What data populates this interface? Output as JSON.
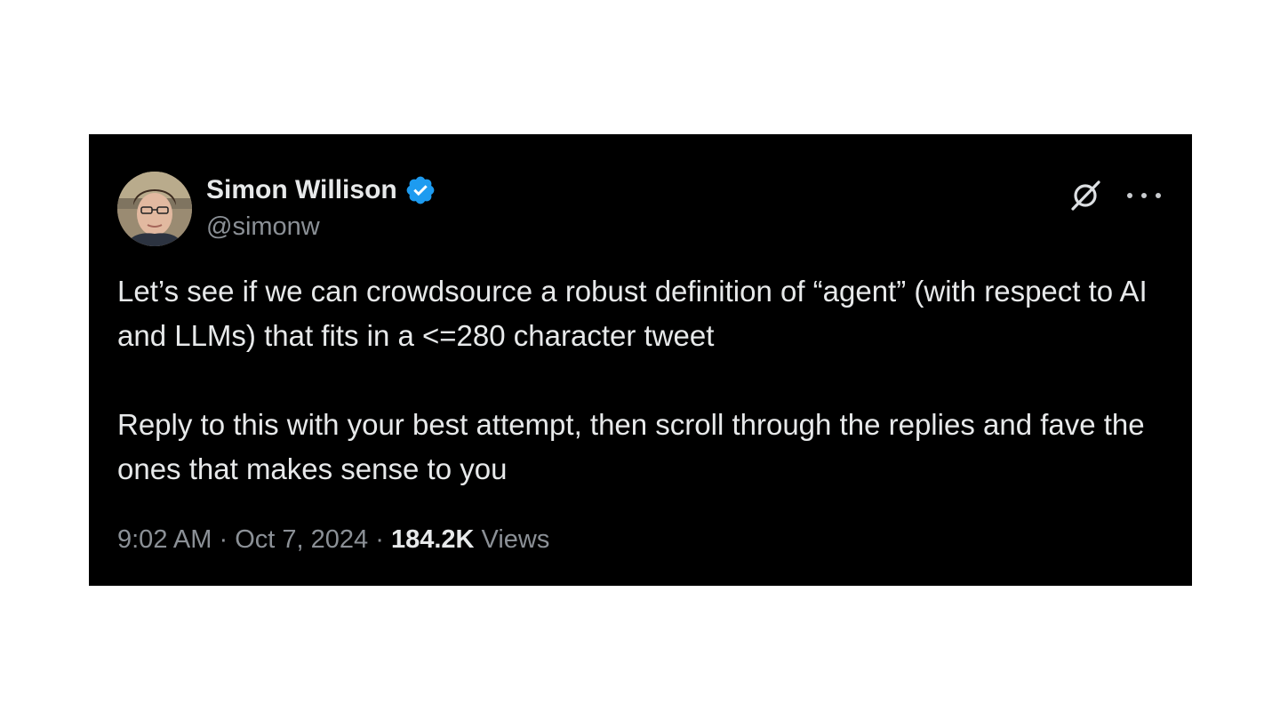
{
  "tweet": {
    "author": {
      "name": "Simon Willison",
      "handle": "@simonw",
      "verified": true
    },
    "text_paragraphs": [
      "Let’s see if we can crowdsource a robust definition of “agent” (with respect to AI and LLMs) that fits in a <=280 character tweet",
      "Reply to this with your best attempt, then scroll through the replies and fave the ones that makes sense to you"
    ],
    "time": "9:02 AM",
    "date": "Oct 7, 2024",
    "separator": "·",
    "views_count": "184.2K",
    "views_label": "Views"
  },
  "icons": {
    "verified": "verified-badge-icon",
    "grok": "grok-icon",
    "more": "more-options-icon"
  },
  "colors": {
    "card_background": "#000000",
    "page_background": "#ffffff",
    "primary_text": "#e7e9ea",
    "secondary_text": "#8b9096",
    "verified_blue": "#1d9bf0"
  }
}
